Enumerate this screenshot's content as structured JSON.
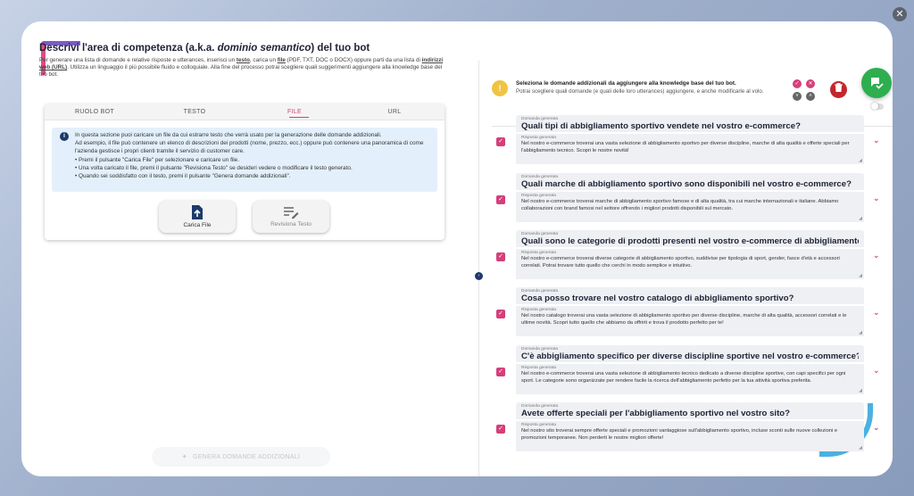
{
  "left": {
    "title_prefix": "Descrivi l'area di competenza (a.k.a. ",
    "title_italic": "dominio semantico",
    "title_suffix": ") del tuo bot",
    "desc_1": "Per generare una lista di domande e relative risposte e utterances, inserisci un ",
    "desc_testo": "testo",
    "desc_2": ", carica un ",
    "desc_file": "file",
    "desc_3": " (PDF, TXT, DOC o DOCX) oppure parti da una lista di ",
    "desc_url": "indirizzi web (URL)",
    "desc_4": ". Utilizza un linguaggio il più possibile fluido e colloquiale. Alla fine del processo potrai scegliere quali suggerimenti aggiungere alla knowledge base del tuo bot."
  },
  "tabs": [
    "RUOLO BOT",
    "TESTO",
    "FILE",
    "URL"
  ],
  "info": {
    "line1": "In questa sezione puoi caricare un file da cui estrarre testo che verrà usato per la generazione delle domande addizionali.",
    "line2": "Ad esempio, il file può contenere un elenco di descrizioni dei prodotti (nome, prezzo, ecc.) oppure può contenere una panoramica di come l'azienda gestisce i propri clienti tramite il servizio di customer care.",
    "line3": "• Premi il pulsante \"Carica File\" per selezionare e caricare un file.",
    "line4": "• Una volta caricato il file, premi il pulsante \"Revisiona Testo\" se desideri vedere o modificare il testo generato.",
    "line5": "• Quando sei soddisfatto con il testo, premi il pulsante \"Genera domande addizionali\"."
  },
  "buttons": {
    "upload": "Carica File",
    "review": "Revisiona Testo",
    "generate": "GENERA DOMANDE ADDIZIONALI"
  },
  "right_header": {
    "title": "Seleziona le domande addizionali da aggiungere alla knowledge base del tuo bot.",
    "subtitle": "Potrai scegliere quali domande (e quali delle loro utterances) aggiungere, e anche modificarle al volo."
  },
  "labels": {
    "question": "Domanda generata",
    "answer": "Risposta generata"
  },
  "questions": [
    {
      "q": "Quali tipi di abbigliamento sportivo vendete nel vostro e-commerce?",
      "a": "Nel nostro e-commerce troverai una vasta selezione di abbigliamento sportivo per diverse discipline, marche di alta qualità e offerte speciali per l'abbigliamento tecnico. Scopri le nostre novità!"
    },
    {
      "q": "Quali marche di abbigliamento sportivo sono disponibili nel vostro e-commerce?",
      "a": "Nel nostro e-commerce troverai marche di abbigliamento sportivo famose e di alta qualità, tra cui marche internazionali e italiane. Abbiamo collaborazioni con brand famosi nel settore offrendo i migliori prodotti disponibili sul mercato."
    },
    {
      "q": "Quali sono le categorie di prodotti presenti nel vostro e-commerce di abbigliamento sportivo?",
      "a": "Nel nostro e-commerce troverai diverse categorie di abbigliamento sportivo, suddivise per tipologia di sport, gender, fasce d'età e accessori correlati. Potrai trovare tutto quello che cerchi in modo semplice e intuitivo."
    },
    {
      "q": "Cosa posso trovare nel vostro catalogo di abbigliamento sportivo?",
      "a": "Nel nostro catalogo troverai una vasta selezione di abbigliamento sportivo per diverse discipline, marche di alta qualità, accessori correlati e le ultime novità. Scopri tutto quello che abbiamo da offrirti e trova il prodotto perfetto per te!"
    },
    {
      "q": "C'è abbigliamento specifico per diverse discipline sportive nel vostro e-commerce?",
      "a": "Nel nostro e-commerce troverai una vasta selezione di abbigliamento tecnico dedicato a diverse discipline sportive, con capi specifici per ogni sport. Le categorie sono organizzate per rendere facile la ricerca dell'abbigliamento perfetto per la tua attività sportiva preferita."
    },
    {
      "q": "Avete offerte speciali per l'abbigliamento sportivo nel vostro sito?",
      "a": "Nel nostro sito troverai sempre offerte speciali e promozioni vantaggiose sull'abbigliamento sportivo, incluse sconti sulle nuove collezioni e promozioni temporanee. Non perderti le nostre migliori offerte!"
    }
  ],
  "colors": {
    "accent": "#d43f7a",
    "primary_dark": "#1e2235",
    "success": "#2eae4f",
    "danger": "#c2272d",
    "info_bg": "#e3f0fb",
    "warning": "#f0c442"
  }
}
